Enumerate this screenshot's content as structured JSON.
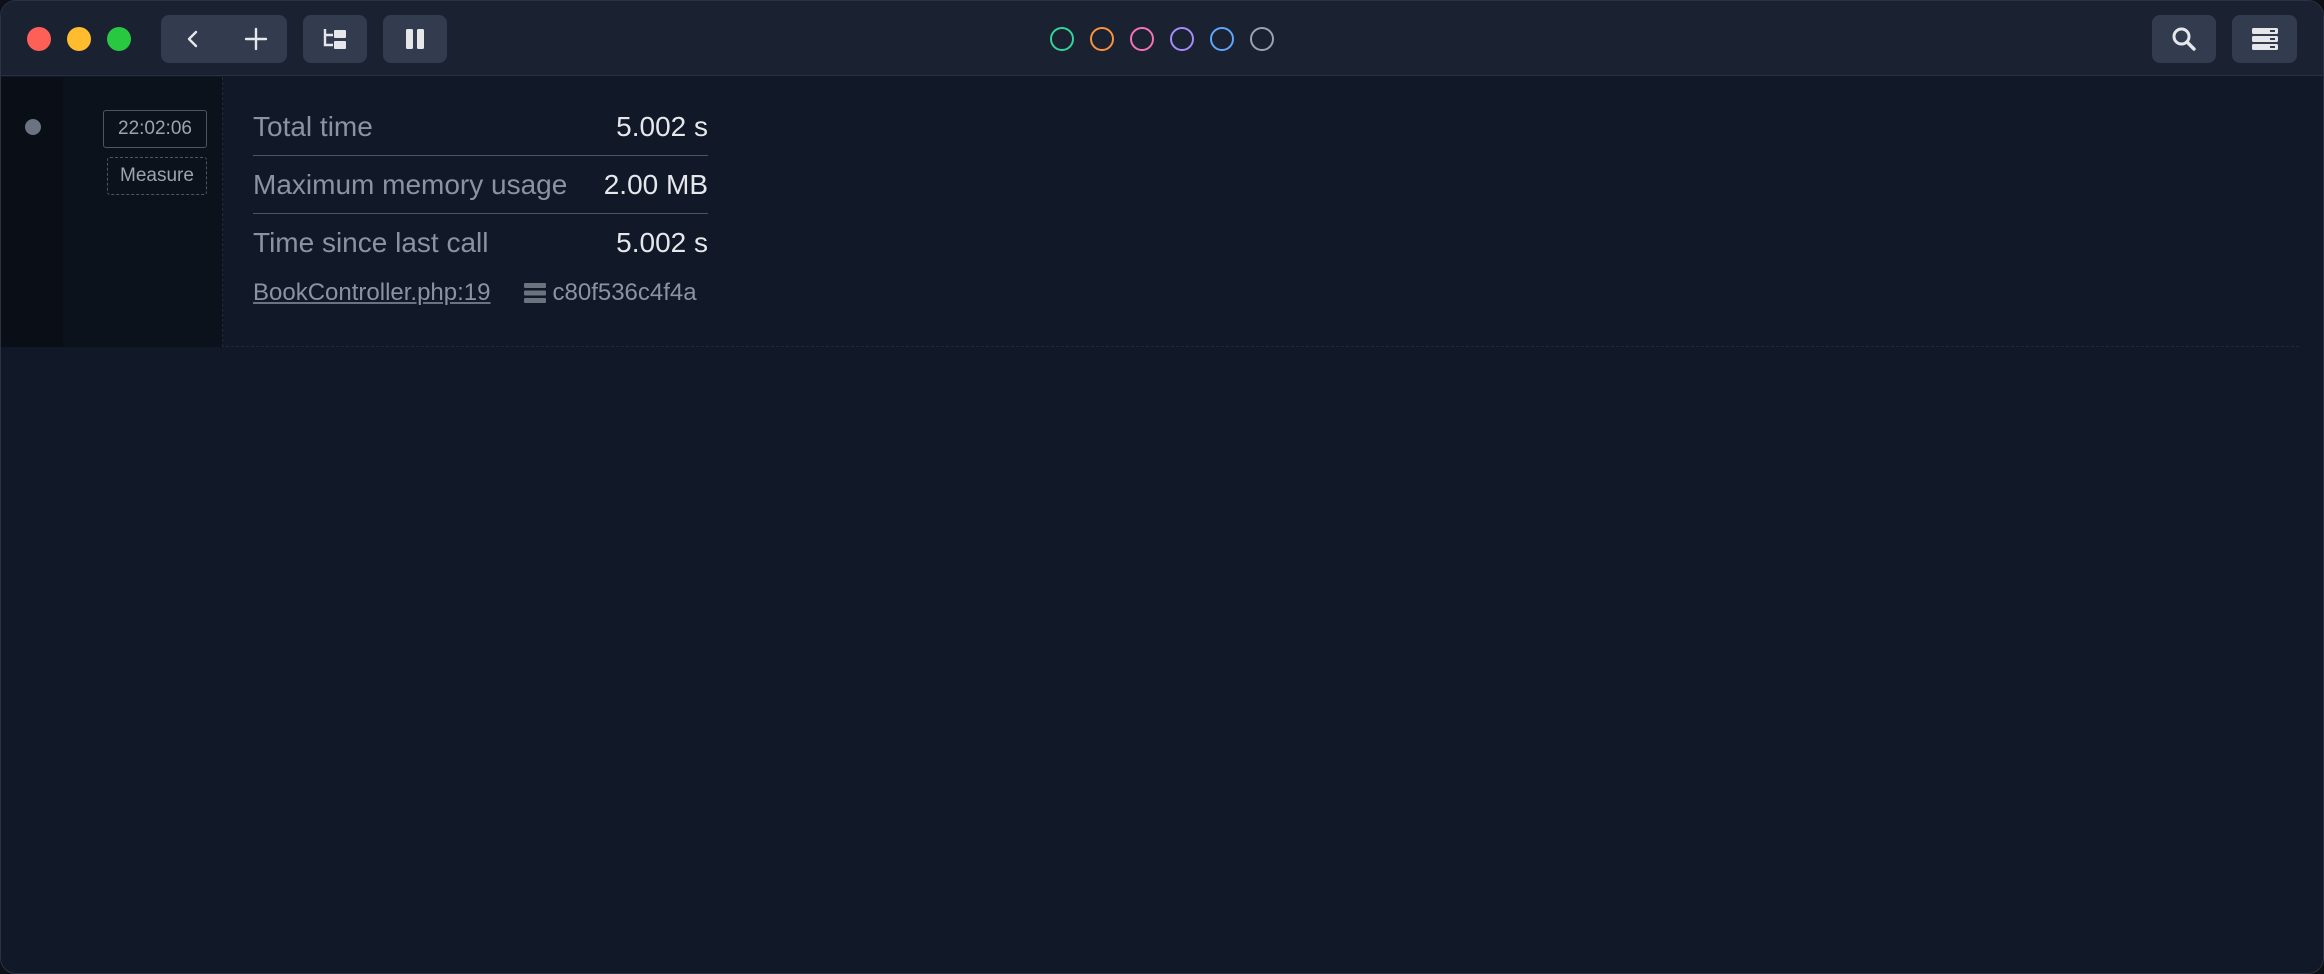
{
  "toolbar": {
    "colors": [
      "#34d399",
      "#fb923c",
      "#f472b6",
      "#a78bfa",
      "#60a5fa",
      "#9ca3af"
    ]
  },
  "entry": {
    "timestamp": "22:02:06",
    "tag": "Measure",
    "metrics": [
      {
        "label": "Total time",
        "value": "5.002 s"
      },
      {
        "label": "Maximum memory usage",
        "value": "2.00 MB"
      },
      {
        "label": "Time since last call",
        "value": "5.002 s"
      }
    ],
    "file": "BookController.php:19",
    "hash": "c80f536c4f4a"
  }
}
